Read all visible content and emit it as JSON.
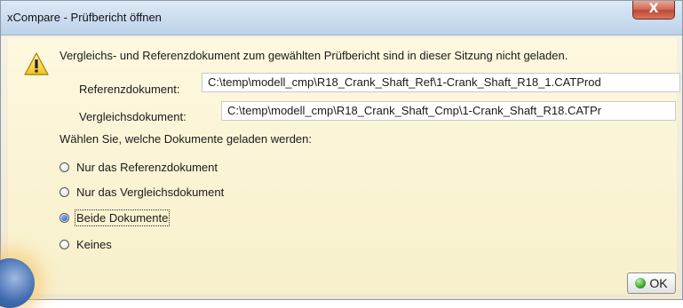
{
  "window": {
    "title": "xCompare - Prüfbericht öffnen",
    "close_label": "X"
  },
  "message": "Vergleichs- und Referenzdokument zum gewählten Prüfbericht sind in dieser Sitzung nicht geladen.",
  "reference": {
    "label": "Referenzdokument:",
    "value": "C:\\temp\\modell_cmp\\R18_Crank_Shaft_Ref\\1-Crank_Shaft_R18_1.CATProd"
  },
  "comparison": {
    "label": "Vergleichsdokument:",
    "value": "C:\\temp\\modell_cmp\\R18_Crank_Shaft_Cmp\\1-Crank_Shaft_R18.CATPr"
  },
  "choose_prompt": "Wählen Sie, welche Dokumente geladen werden:",
  "options": [
    {
      "label": "Nur das Referenzdokument",
      "selected": false
    },
    {
      "label": "Nur das Vergleichsdokument",
      "selected": false
    },
    {
      "label": "Beide Dokumente",
      "selected": true
    },
    {
      "label": "Keines",
      "selected": false
    }
  ],
  "ok_label": "OK",
  "icons": {
    "warning": "warning-triangle-icon",
    "ok": "green-dot-icon",
    "close": "close-icon"
  }
}
